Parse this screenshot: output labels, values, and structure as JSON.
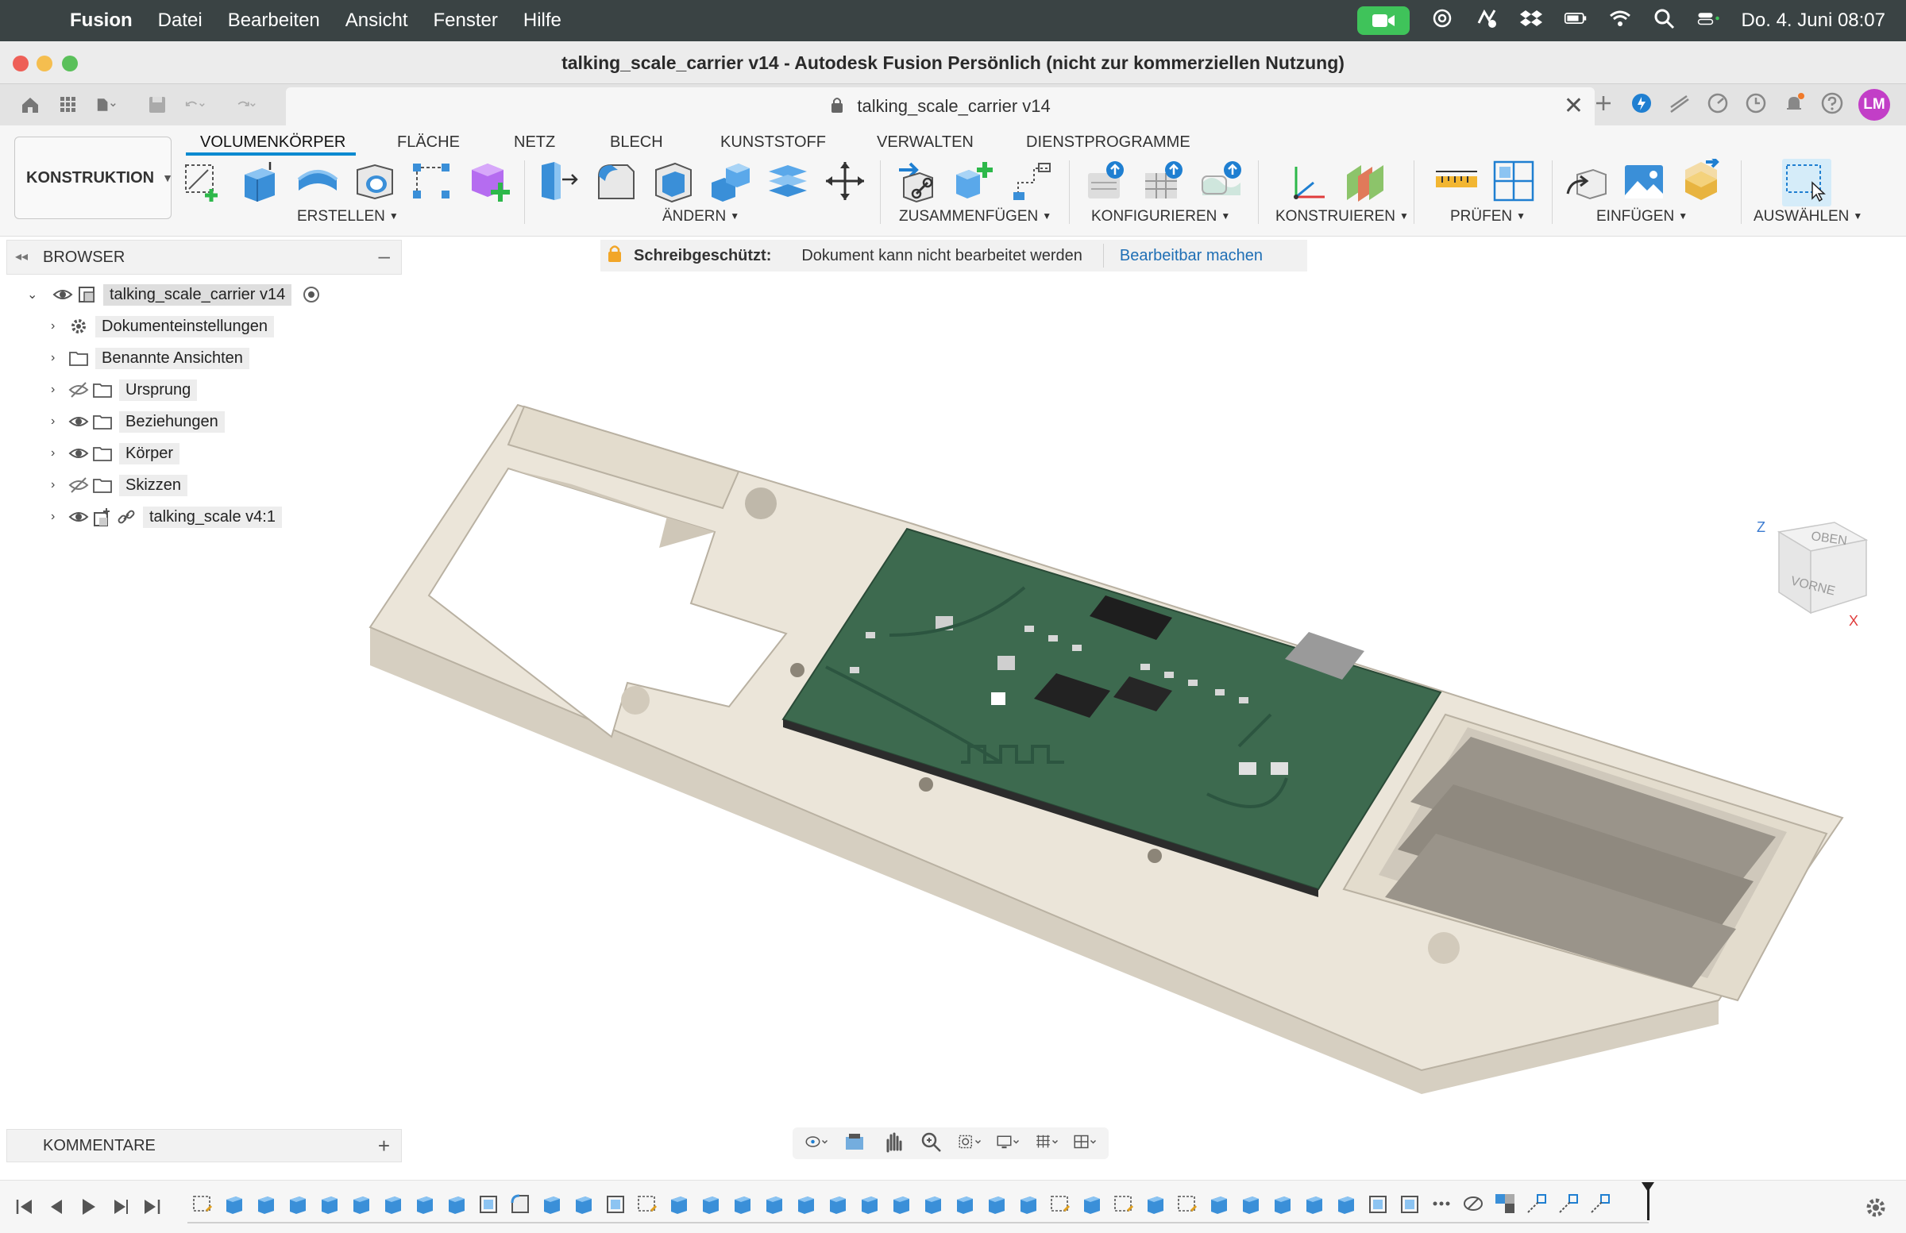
{
  "menubar": {
    "app": "Fusion",
    "items": [
      "Datei",
      "Bearbeiten",
      "Ansicht",
      "Fenster",
      "Hilfe"
    ],
    "clock": "Do. 4. Juni  08:07"
  },
  "window": {
    "title": "talking_scale_carrier v14 - Autodesk Fusion Persönlich (nicht zur kommerziellen Nutzung)"
  },
  "document_tab": {
    "label": "talking_scale_carrier v14",
    "close": "✕"
  },
  "user": {
    "initials": "LM",
    "color": "#c23ec7"
  },
  "toolbar": {
    "workspace": "KONSTRUKTION",
    "tabs": [
      "VOLUMENKÖRPER",
      "FLÄCHE",
      "NETZ",
      "BLECH",
      "KUNSTSTOFF",
      "VERWALTEN",
      "DIENSTPROGRAMME"
    ],
    "active_tab": "VOLUMENKÖRPER",
    "groups": {
      "erstellen": "ERSTELLEN",
      "aendern": "ÄNDERN",
      "zusammenfuegen": "ZUSAMMENFÜGEN",
      "konfigurieren": "KONFIGURIEREN",
      "konstruieren": "KONSTRUIEREN",
      "pruefen": "PRÜFEN",
      "einfuegen": "EINFÜGEN",
      "auswaehlen": "AUSWÄHLEN"
    },
    "accent": "#0a8ad0"
  },
  "browser": {
    "title": "BROWSER",
    "root": "talking_scale_carrier v14",
    "items": [
      {
        "label": "Dokumenteinstellungen",
        "icon": "gear-icon"
      },
      {
        "label": "Benannte Ansichten",
        "icon": "folder-icon"
      },
      {
        "label": "Ursprung",
        "icon": "folder-icon",
        "visibility": "hidden"
      },
      {
        "label": "Beziehungen",
        "icon": "folder-icon",
        "visibility": "visible"
      },
      {
        "label": "Körper",
        "icon": "folder-icon",
        "visibility": "visible"
      },
      {
        "label": "Skizzen",
        "icon": "folder-icon",
        "visibility": "hidden"
      },
      {
        "label": "talking_scale v4:1",
        "icon": "component-link-icon",
        "visibility": "visible"
      }
    ]
  },
  "banner": {
    "status": "Schreibgeschützt:",
    "message": "Dokument kann nicht bearbeitet werden",
    "action": "Bearbeitbar machen"
  },
  "viewcube": {
    "top": "OBEN",
    "front": "VORNE",
    "z": "Z",
    "x": "X"
  },
  "comments": {
    "title": "KOMMENTARE",
    "add": "+"
  },
  "colors": {
    "pcb_green": "#3d6a4f",
    "carrier_beige": "#ebe5d9",
    "menubar": "#3a4344"
  }
}
